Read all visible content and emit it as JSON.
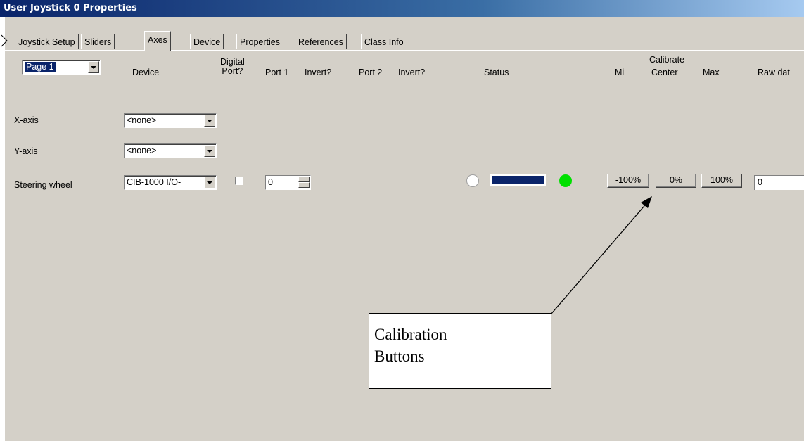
{
  "window": {
    "title": "User Joystick 0 Properties"
  },
  "tabs": [
    {
      "label": "Joystick Setup",
      "active": false
    },
    {
      "label": "Sliders",
      "active": false
    },
    {
      "label": "Axes",
      "active": true
    },
    {
      "label": "Device",
      "active": false
    },
    {
      "label": "Properties",
      "active": false
    },
    {
      "label": "References",
      "active": false
    },
    {
      "label": "Class Info",
      "active": false
    }
  ],
  "page_selector": {
    "value": "Page 1"
  },
  "headers": {
    "device": "Device",
    "digital_port_line1": "Digital",
    "digital_port_line2": "Port?",
    "port1": "Port 1",
    "invert1": "Invert?",
    "port2": "Port 2",
    "invert2": "Invert?",
    "status": "Status",
    "min": "Mi",
    "calibrate": "Calibrate",
    "center": "Center",
    "max": "Max",
    "raw_data": "Raw dat"
  },
  "rows": [
    {
      "label": "X-axis",
      "device": "<none>"
    },
    {
      "label": "Y-axis",
      "device": "<none>"
    },
    {
      "label": "Steering wheel",
      "device": "CIB-1000 I/O-",
      "port1": "0",
      "calibration": {
        "min": "-100%",
        "center": "0%",
        "max": "100%"
      },
      "raw_data": "0"
    }
  ],
  "colors": {
    "status_bar": "#0a246a",
    "status_led": "#00e000"
  },
  "callout": {
    "line1": "Calibration",
    "line2": "Buttons"
  }
}
